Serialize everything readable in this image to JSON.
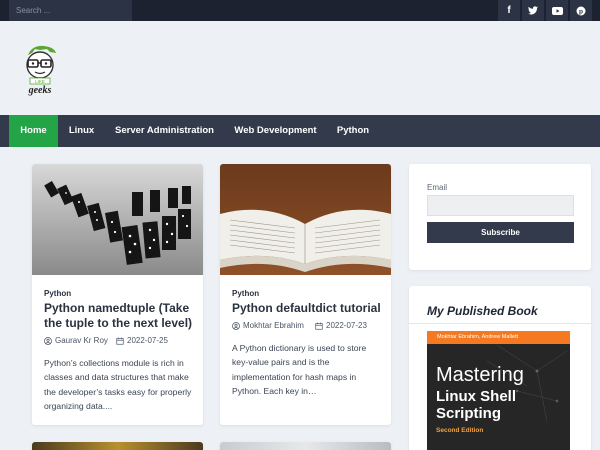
{
  "topbar": {
    "search_placeholder": "Search ...",
    "social": [
      {
        "icon": "facebook-icon",
        "glyph": "f"
      },
      {
        "icon": "twitter-icon",
        "glyph": "t"
      },
      {
        "icon": "youtube-icon",
        "glyph": "▶"
      },
      {
        "icon": "pinterest-icon",
        "glyph": "p"
      }
    ]
  },
  "logo": {
    "text": "geeks",
    "badge": "LIKE"
  },
  "nav": {
    "items": [
      {
        "label": "Home",
        "active": true
      },
      {
        "label": "Linux"
      },
      {
        "label": "Server Administration"
      },
      {
        "label": "Web Development"
      },
      {
        "label": "Python"
      }
    ]
  },
  "posts": [
    {
      "category": "Python",
      "title": "Python namedtuple (Take the tuple to the next level)",
      "author": "Gaurav Kr Roy",
      "date": "2022-07-25",
      "excerpt": "Python’s collections module is rich in classes and data structures that make the developer’s tasks easy for properly organizing data...."
    },
    {
      "category": "Python",
      "title": "Python defaultdict tutorial",
      "author": "Mokhtar Ebrahim",
      "date": "2022-07-23",
      "excerpt": "A Python dictionary is used to store key-value pairs and is the implementation for hash maps in Python. Each key in…"
    }
  ],
  "subscribe_widget": {
    "email_label": "Email",
    "button_label": "Subscribe"
  },
  "book_widget": {
    "title": "My Published Book",
    "cover": {
      "authors": "Mokhtar Ebrahim, Andrew Mallett",
      "line1": "Mastering",
      "line2": "Linux Shell",
      "line3": "Scripting",
      "edition": "Second Edition"
    }
  },
  "colors": {
    "accent": "#22a447",
    "nav": "#323a4b",
    "topbar": "#1c2230",
    "book_orange": "#f47920"
  }
}
